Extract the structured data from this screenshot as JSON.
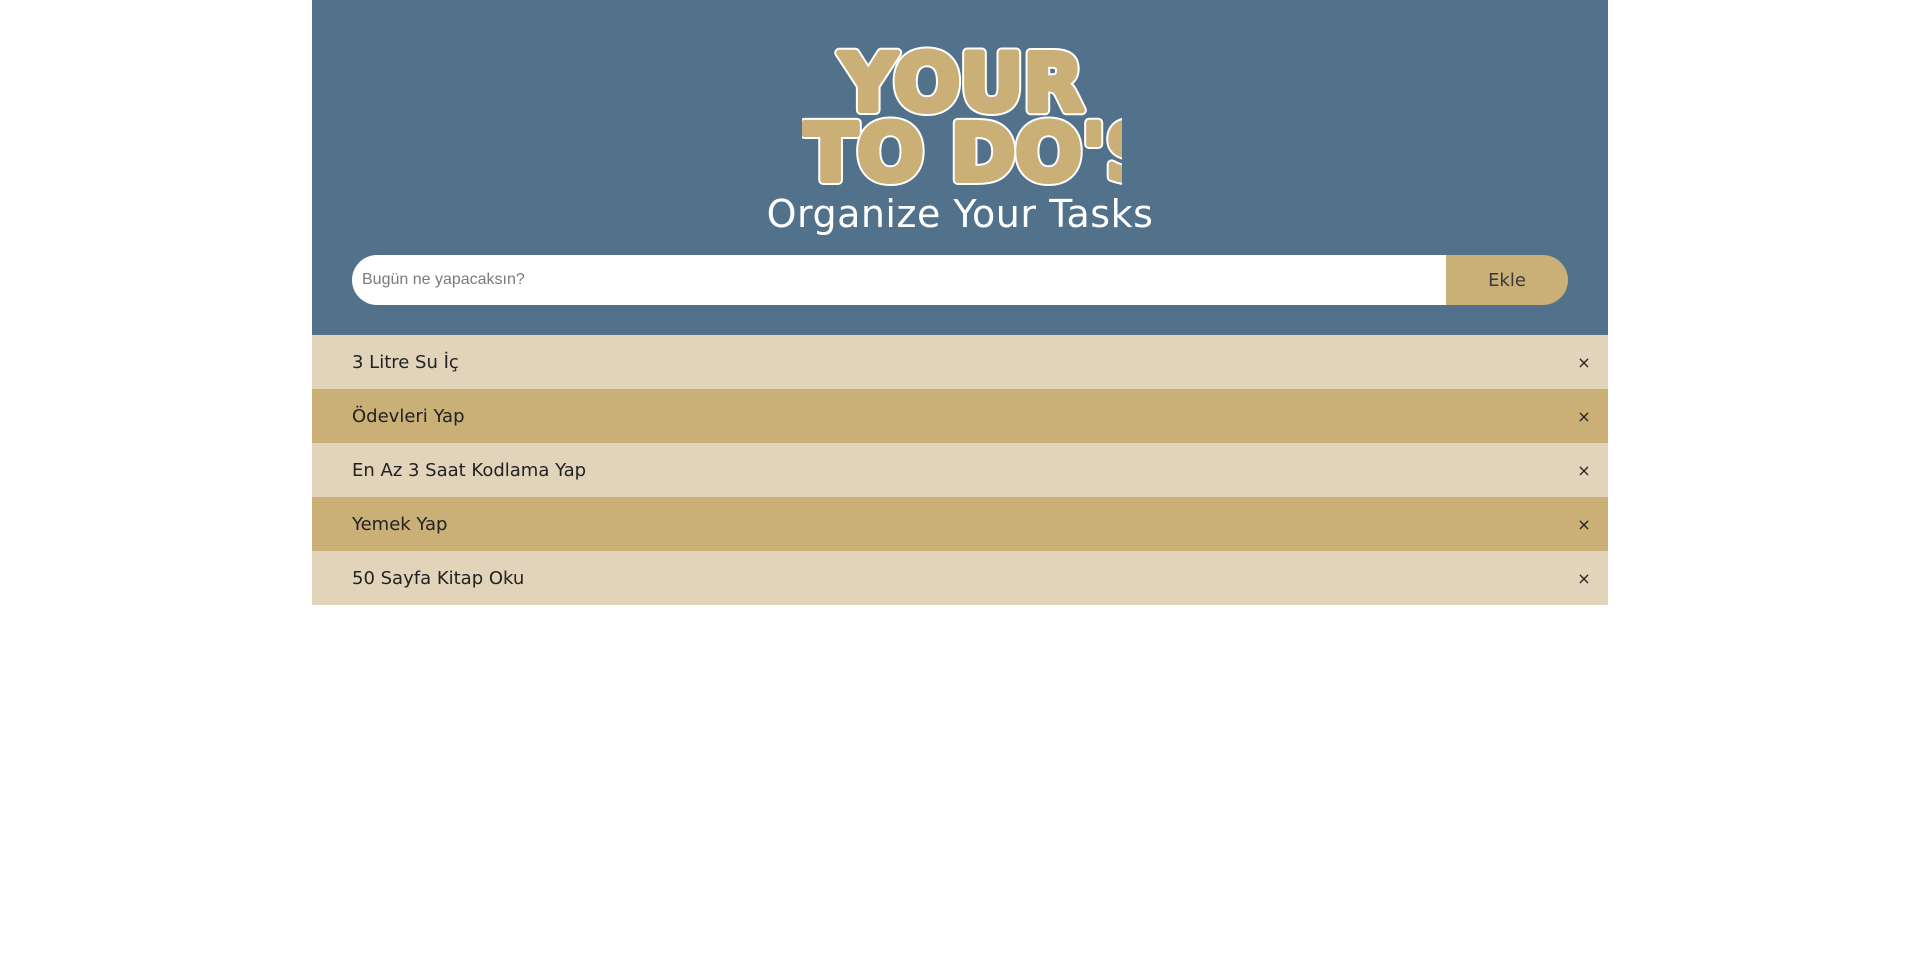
{
  "header": {
    "logo_text": "YOUR TO DO'S",
    "subtitle": "Organize Your Tasks"
  },
  "form": {
    "placeholder": "Bugün ne yapacaksın?",
    "value": "",
    "add_label": "Ekle"
  },
  "todos": [
    {
      "text": "3 Litre Su İç",
      "delete": "×"
    },
    {
      "text": "Ödevleri Yap",
      "delete": "×"
    },
    {
      "text": "En Az 3 Saat Kodlama Yap",
      "delete": "×"
    },
    {
      "text": "Yemek Yap",
      "delete": "×"
    },
    {
      "text": "50 Sayfa Kitap Oku",
      "delete": "×"
    }
  ],
  "colors": {
    "header_bg": "#52718b",
    "accent": "#caaf77",
    "row_light": "#e1d4bb",
    "logo_fill": "#caaf77",
    "logo_outline": "#ffffff"
  }
}
